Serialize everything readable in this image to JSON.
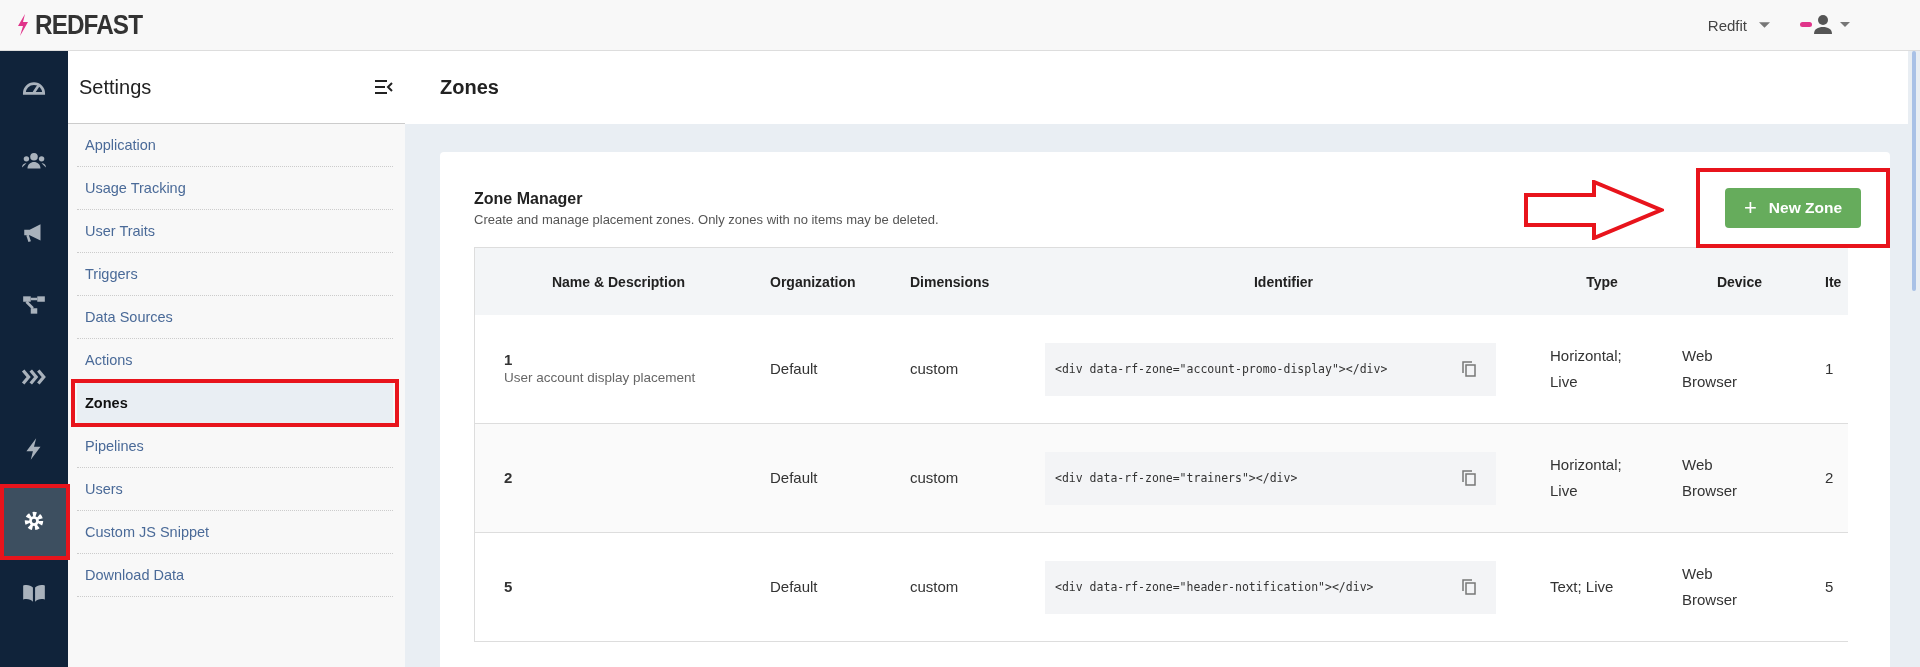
{
  "brand": {
    "name": "REDFAST"
  },
  "account": {
    "org": "Redfit"
  },
  "rail": [
    {
      "selected": false
    },
    {
      "selected": false
    },
    {
      "selected": false
    },
    {
      "selected": false
    },
    {
      "selected": false
    },
    {
      "selected": false
    },
    {
      "selected": true
    },
    {
      "selected": false
    }
  ],
  "settings": {
    "title": "Settings",
    "items": [
      {
        "label": "Application",
        "selected": false
      },
      {
        "label": "Usage Tracking",
        "selected": false
      },
      {
        "label": "User Traits",
        "selected": false
      },
      {
        "label": "Triggers",
        "selected": false
      },
      {
        "label": "Data Sources",
        "selected": false
      },
      {
        "label": "Actions",
        "selected": false
      },
      {
        "label": "Zones",
        "selected": true
      },
      {
        "label": "Pipelines",
        "selected": false
      },
      {
        "label": "Users",
        "selected": false
      },
      {
        "label": "Custom JS Snippet",
        "selected": false
      },
      {
        "label": "Download Data",
        "selected": false
      }
    ]
  },
  "page": {
    "title": "Zones"
  },
  "zone_manager": {
    "title": "Zone Manager",
    "subtitle": "Create and manage placement zones. Only zones with no items may be deleted.",
    "new_button": {
      "icon": "+",
      "label": "New Zone"
    }
  },
  "table": {
    "columns": [
      "Name & Description",
      "Organization",
      "Dimensions",
      "Identifier",
      "Type",
      "Device",
      "Ite"
    ],
    "rows": [
      {
        "name": "1",
        "description": "User account display placement",
        "organization": "Default",
        "dimensions": "custom",
        "identifier": "<div data-rf-zone=\"account-promo-display\"></div>",
        "type": "Horizontal; Live",
        "device": "Web Browser",
        "items": "1"
      },
      {
        "name": "2",
        "organization": "Default",
        "dimensions": "custom",
        "identifier": "<div data-rf-zone=\"trainers\"></div>",
        "type": "Horizontal; Live",
        "device": "Web Browser",
        "items": "2"
      },
      {
        "name": "5",
        "organization": "Default",
        "dimensions": "custom",
        "identifier": "<div data-rf-zone=\"header-notification\"></div>",
        "type": "Text; Live",
        "device": "Web Browser",
        "items": "5"
      }
    ]
  }
}
